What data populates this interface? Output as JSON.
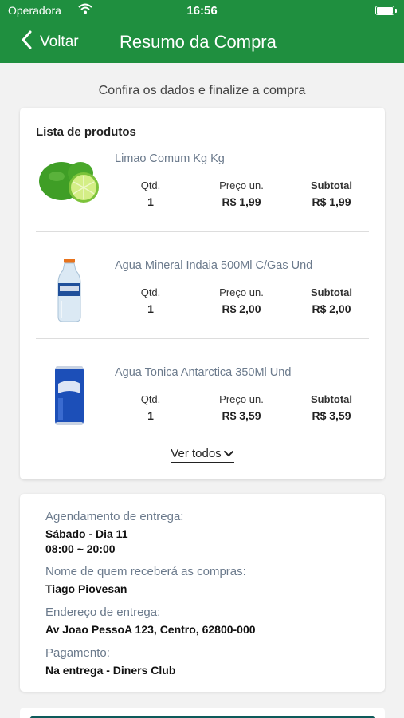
{
  "status_bar": {
    "carrier": "Operadora",
    "time": "16:56"
  },
  "nav": {
    "back_label": "Voltar",
    "title": "Resumo da Compra"
  },
  "subtitle": "Confira os dados e finalize a compra",
  "products_card": {
    "title": "Lista de produtos",
    "qty_header": "Qtd.",
    "price_header": "Preço un.",
    "subtotal_header": "Subtotal",
    "items": [
      {
        "name": "Limao Comum Kg Kg",
        "qty": "1",
        "unit_price": "R$ 1,99",
        "subtotal": "R$ 1,99",
        "image": "lime-fruit"
      },
      {
        "name": "Agua Mineral Indaia 500Ml C/Gas Und",
        "qty": "1",
        "unit_price": "R$ 2,00",
        "subtotal": "R$ 2,00",
        "image": "water-bottle"
      },
      {
        "name": "Agua Tonica Antarctica 350Ml Und",
        "qty": "1",
        "unit_price": "R$ 3,59",
        "subtotal": "R$ 3,59",
        "image": "tonic-can"
      }
    ],
    "see_all": "Ver todos"
  },
  "delivery_card": {
    "schedule_label": "Agendamento de entrega:",
    "schedule_day": "Sábado - Dia 11",
    "schedule_time": "08:00 ~ 20:00",
    "receiver_label": "Nome de quem receberá as compras:",
    "receiver_name": "Tiago Piovesan",
    "address_label": "Endereço de entrega:",
    "address_value": "Av Joao PessoA 123, Centro, 62800-000",
    "payment_label": "Pagamento:",
    "payment_value": "Na entrega - Diners Club"
  },
  "colors": {
    "header": "#1f8f3f",
    "background": "#f2f2f2",
    "product_name": "#6b7a8c",
    "footer_button": "#0d5a5a"
  }
}
